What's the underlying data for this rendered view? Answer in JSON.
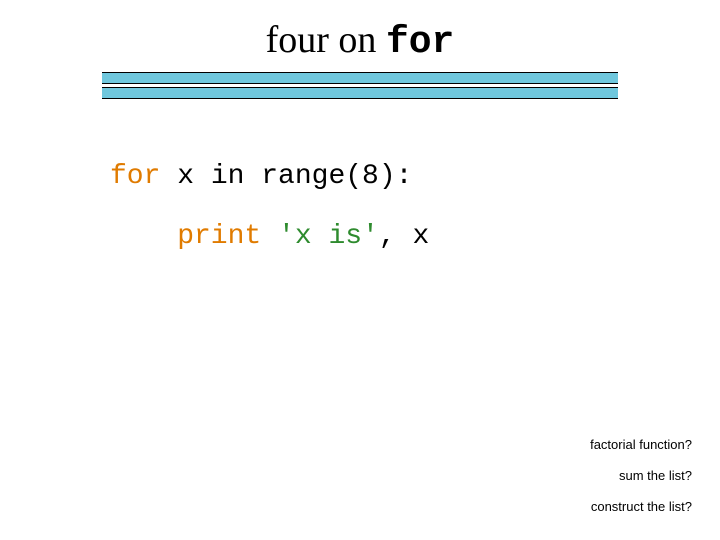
{
  "title": {
    "serif_part": "four on ",
    "mono_part": "for"
  },
  "code": {
    "line1": {
      "kw_for": "for",
      "rest": " x in range(8):"
    },
    "line2": {
      "kw_print": "print",
      "space1": " ",
      "str": "'x is'",
      "tail": ", x"
    }
  },
  "notes": {
    "n1": "factorial function?",
    "n2": "sum the list?",
    "n3": "construct the list?"
  }
}
